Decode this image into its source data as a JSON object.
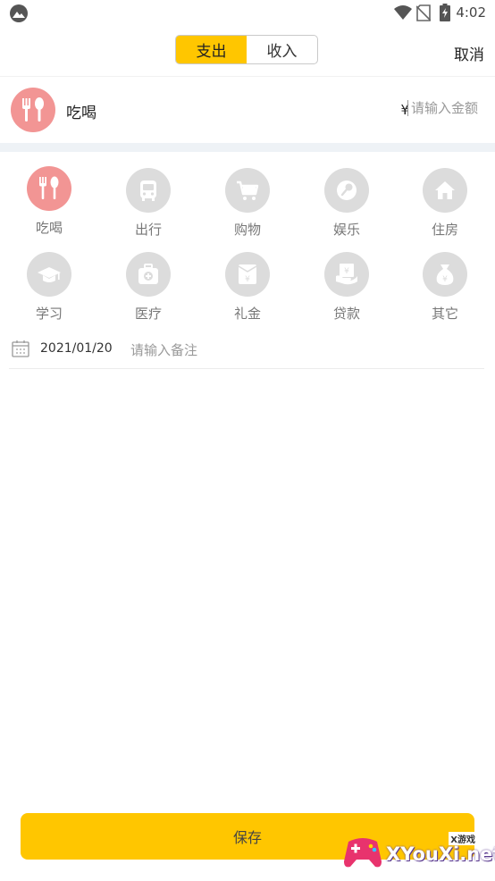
{
  "status": {
    "time": "4:02"
  },
  "header": {
    "tabs": [
      {
        "label": "支出",
        "active": true
      },
      {
        "label": "收入",
        "active": false
      }
    ],
    "cancel": "取消"
  },
  "selected": {
    "label": "吃喝",
    "currency": "¥",
    "amount_placeholder": "请输入金额"
  },
  "categories": [
    {
      "label": "吃喝",
      "icon": "fork-spoon-icon",
      "selected": true
    },
    {
      "label": "出行",
      "icon": "bus-icon",
      "selected": false
    },
    {
      "label": "购物",
      "icon": "shopping-cart-icon",
      "selected": false
    },
    {
      "label": "娱乐",
      "icon": "microphone-icon",
      "selected": false
    },
    {
      "label": "住房",
      "icon": "house-icon",
      "selected": false
    },
    {
      "label": "学习",
      "icon": "graduation-cap-icon",
      "selected": false
    },
    {
      "label": "医疗",
      "icon": "medical-kit-icon",
      "selected": false
    },
    {
      "label": "礼金",
      "icon": "red-envelope-icon",
      "selected": false
    },
    {
      "label": "贷款",
      "icon": "loan-card-icon",
      "selected": false
    },
    {
      "label": "其它",
      "icon": "money-bag-icon",
      "selected": false
    }
  ],
  "note_row": {
    "date": "2021/01/20",
    "note_placeholder": "请输入备注"
  },
  "save_label": "保存",
  "watermark": {
    "text": "XYouXi.net",
    "small": "X游戏"
  },
  "colors": {
    "accent": "#ffc600",
    "selected_icon": "#f29594",
    "icon_bg": "#dcdcdc"
  }
}
